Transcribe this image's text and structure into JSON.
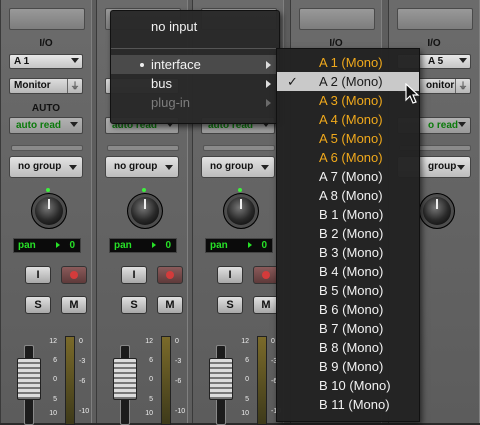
{
  "strips": [
    {
      "io_label": "I/O",
      "io_value": "A 1",
      "monitor": "Monitor",
      "auto_label": "AUTO",
      "auto_mode": "auto read",
      "group": "no group",
      "pan_label": "pan",
      "pan_value": "0"
    },
    {
      "io_label": "",
      "io_value": "",
      "monitor": "",
      "auto_label": "",
      "auto_mode": "auto read",
      "group": "no group",
      "pan_label": "pan",
      "pan_value": "0"
    },
    {
      "io_label": "",
      "io_value": "",
      "monitor": "",
      "auto_label": "",
      "auto_mode": "auto read",
      "group": "no group",
      "pan_label": "pan",
      "pan_value": "0"
    },
    {
      "io_label": "I/O",
      "io_value": "",
      "monitor": "",
      "auto_label": "",
      "auto_mode": "",
      "group": "",
      "pan_label": "",
      "pan_value": ""
    },
    {
      "io_label": "I/O",
      "io_value": "A 5",
      "monitor": "onitor",
      "auto_label": "",
      "auto_mode": "o read",
      "group": "group",
      "pan_label": "",
      "pan_value": ""
    }
  ],
  "buttons": {
    "input": "I",
    "solo": "S",
    "mute": "M"
  },
  "fader_scale": [
    "12",
    "6",
    "0",
    "5",
    "10"
  ],
  "meter_scale": [
    "0",
    "-3",
    "-6",
    "-10"
  ],
  "context_menu": {
    "no_input": "no input",
    "items": [
      {
        "label": "interface",
        "bullet": true,
        "highlighted": true,
        "disabled": false
      },
      {
        "label": "bus",
        "bullet": false,
        "highlighted": false,
        "disabled": false
      },
      {
        "label": "plug-in",
        "bullet": false,
        "highlighted": false,
        "disabled": true
      }
    ]
  },
  "submenu": {
    "items": [
      {
        "label": "A 1 (Mono)",
        "style": "orange"
      },
      {
        "label": "A 2 (Mono)",
        "style": "selected",
        "checked": true
      },
      {
        "label": "A 3 (Mono)",
        "style": "orange"
      },
      {
        "label": "A 4 (Mono)",
        "style": "orange"
      },
      {
        "label": "A 5 (Mono)",
        "style": "orange"
      },
      {
        "label": "A 6 (Mono)",
        "style": "orange"
      },
      {
        "label": "A 7 (Mono)",
        "style": "normal"
      },
      {
        "label": "A 8 (Mono)",
        "style": "normal"
      },
      {
        "label": "B 1 (Mono)",
        "style": "normal"
      },
      {
        "label": "B 2 (Mono)",
        "style": "normal"
      },
      {
        "label": "B 3 (Mono)",
        "style": "normal"
      },
      {
        "label": "B 4 (Mono)",
        "style": "normal"
      },
      {
        "label": "B 5 (Mono)",
        "style": "normal"
      },
      {
        "label": "B 6 (Mono)",
        "style": "normal"
      },
      {
        "label": "B 7 (Mono)",
        "style": "normal"
      },
      {
        "label": "B 8 (Mono)",
        "style": "normal"
      },
      {
        "label": "B 9 (Mono)",
        "style": "normal"
      },
      {
        "label": "B 10 (Mono)",
        "style": "normal"
      },
      {
        "label": "B 11 (Mono)",
        "style": "normal"
      }
    ],
    "check_mark": "✓"
  },
  "colors": {
    "orange": "#f0a91c",
    "green": "#27e027",
    "menu_bg": "#282828"
  }
}
